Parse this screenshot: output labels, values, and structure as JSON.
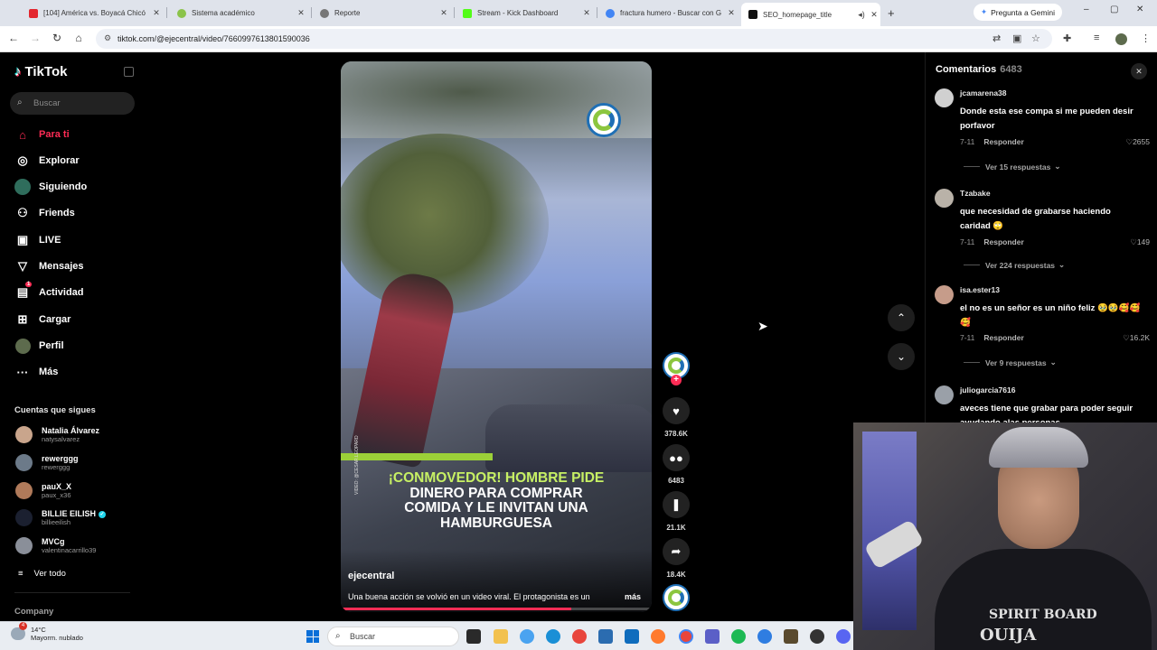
{
  "browser": {
    "tabs": [
      {
        "label": "[104] América vs. Boyacá Chicó",
        "color": "#e3262e",
        "icon": "youtube-icon"
      },
      {
        "label": "Sistema académico",
        "color": "#8bc34a",
        "icon": "site-icon"
      },
      {
        "label": "Reporte",
        "color": "#777777",
        "icon": "globe-icon"
      },
      {
        "label": "Stream - Kick Dashboard",
        "color": "#53fc18",
        "icon": "kick-icon"
      },
      {
        "label": "fractura humero - Buscar con G",
        "color": "#4285f4",
        "icon": "google-icon"
      },
      {
        "label": "SEO_homepage_title",
        "color": "#111111",
        "icon": "tiktok-icon",
        "active": true
      }
    ],
    "new_tab": "+",
    "gemini_label": "Pregunta a Gemini",
    "url": "tiktok.com/@ejecentral/video/7660997613801590036",
    "window_controls": {
      "minimize": "–",
      "maximize": "▢",
      "close": "✕"
    }
  },
  "sidebar": {
    "logo": "TikTok",
    "search_placeholder": "Buscar",
    "nav": [
      {
        "label": "Para ti",
        "icon": "home-icon",
        "glyph": "⌂",
        "active": true
      },
      {
        "label": "Explorar",
        "icon": "compass-icon",
        "glyph": "◎"
      },
      {
        "label": "Siguiendo",
        "icon": "following-avatar-icon",
        "glyph": "●"
      },
      {
        "label": "Friends",
        "icon": "friends-icon",
        "glyph": "👥"
      },
      {
        "label": "LIVE",
        "icon": "live-icon",
        "glyph": "▣"
      },
      {
        "label": "Mensajes",
        "icon": "messages-icon",
        "glyph": "▽"
      },
      {
        "label": "Actividad",
        "icon": "activity-icon",
        "glyph": "▤",
        "badge": "1"
      },
      {
        "label": "Cargar",
        "icon": "upload-icon",
        "glyph": "⊞"
      },
      {
        "label": "Perfil",
        "icon": "profile-avatar-icon",
        "glyph": "●"
      },
      {
        "label": "Más",
        "icon": "more-icon",
        "glyph": "···"
      }
    ],
    "following_title": "Cuentas que sigues",
    "following": [
      {
        "name": "Natalia Álvarez",
        "user": "natysalvarez",
        "color": "#c9a58c"
      },
      {
        "name": "rewerggg",
        "user": "rewerggg",
        "color": "#6c7a89"
      },
      {
        "name": "pauX_X",
        "user": "paux_x36",
        "color": "#b07a5a"
      },
      {
        "name": "BILLIE EILISH",
        "user": "billieeilish",
        "color": "#1b2030",
        "verified": true
      },
      {
        "name": "MVCg",
        "user": "valentinacarrillo39",
        "color": "#8a8f99"
      }
    ],
    "see_all": "Ver todo",
    "company": "Company"
  },
  "video": {
    "headline_green": "¡CONMOVEDOR! HOMBRE PIDE",
    "headline_white_1": "DINERO PARA COMPRAR",
    "headline_white_2": "COMIDA Y LE INVITAN UNA",
    "headline_white_3": "HAMBURGUESA",
    "credit": "VIDEO: @CESAR.LEOPARD",
    "author": "ejecentral",
    "description": "Una buena acción se volvió en un video viral. El protagonista es un",
    "more": "más",
    "progress": 0.74
  },
  "actions": {
    "likes": "378.6K",
    "comments": "6483",
    "saves": "21.1K",
    "shares": "18.4K"
  },
  "comments": {
    "title": "Comentarios",
    "count": "6483",
    "items": [
      {
        "user": "jcamarena38",
        "text": "Donde esta ese compa si me pueden desir porfavor",
        "date": "7-11",
        "reply": "Responder",
        "likes": "2655",
        "view_more": "Ver 15 respuestas",
        "color": "#d0d0d0"
      },
      {
        "user": "Tzabake",
        "text": "que necesidad de grabarse haciendo caridad 🙄",
        "date": "7-11",
        "reply": "Responder",
        "likes": "149",
        "view_more": "Ver 224 respuestas",
        "color": "#b9b2a8"
      },
      {
        "user": "isa.ester13",
        "text": "el no es un señor es un niño feliz 🥹🥹🥰🥰🥰",
        "date": "7-11",
        "reply": "Responder",
        "likes": "16.2K",
        "view_more": "Ver 9 respuestas",
        "color": "#c69c8a"
      },
      {
        "user": "juliogarcia7616",
        "text": "aveces tiene que grabar para poder seguir ayudando alas personas",
        "color": "#9aa0a8"
      }
    ]
  },
  "webcam": {
    "shirt_text_1": "SPIRIT BOARD",
    "shirt_text_2": "OUIJA"
  },
  "taskbar": {
    "weather_temp": "14°C",
    "weather_desc": "Mayorm. nublado",
    "weather_badge": "4",
    "search_label": "Buscar"
  }
}
